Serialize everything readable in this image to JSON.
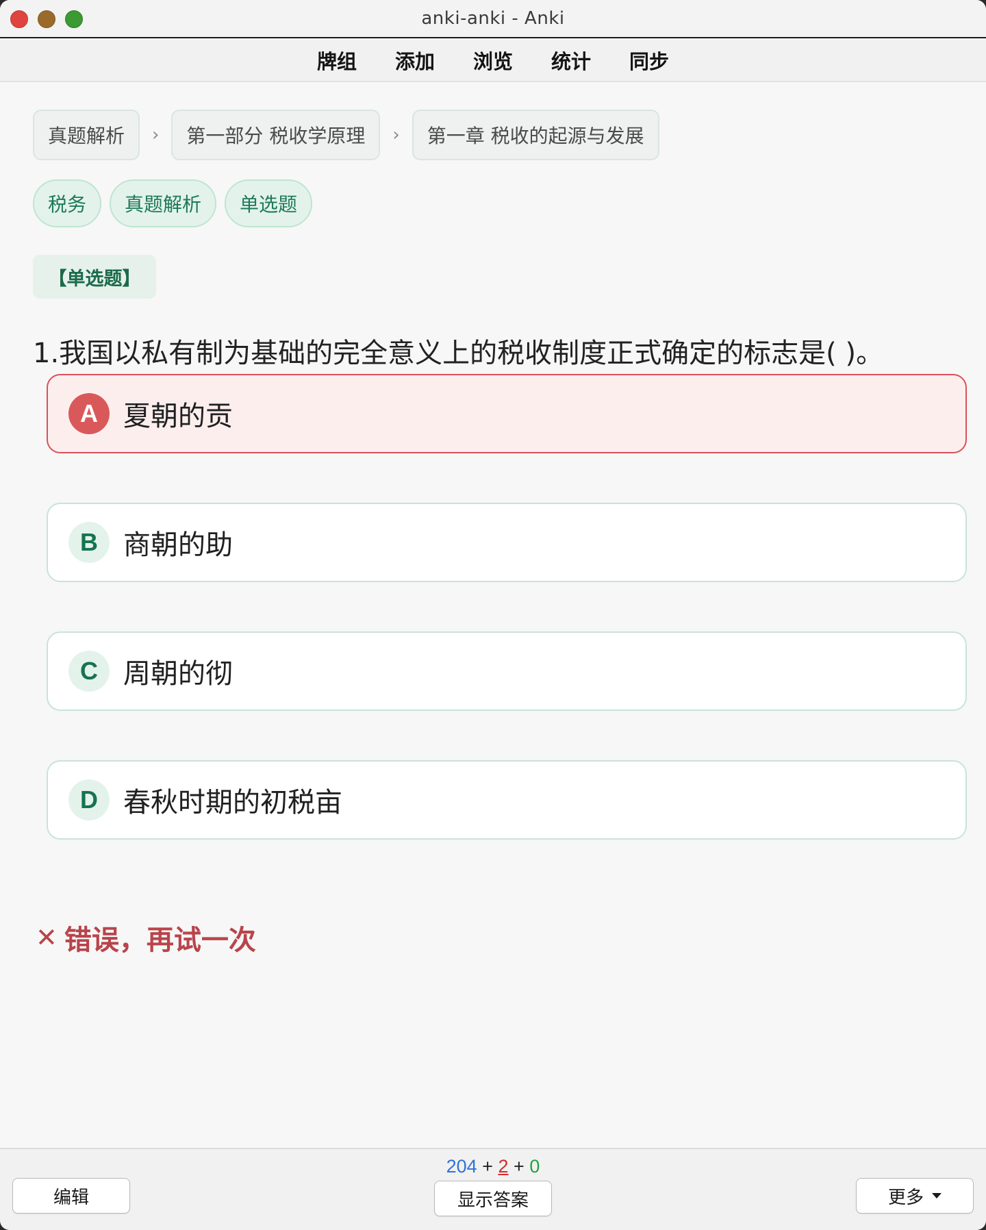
{
  "window": {
    "title": "anki-anki - Anki"
  },
  "toolbar": {
    "items": [
      "牌组",
      "添加",
      "浏览",
      "统计",
      "同步"
    ]
  },
  "breadcrumb": {
    "items": [
      "真题解析",
      "第一部分 税收学原理",
      "第一章 税收的起源与发展"
    ],
    "separator": "›"
  },
  "tags": [
    "税务",
    "真题解析",
    "单选题"
  ],
  "question": {
    "type_label": "【单选题】",
    "text": "1.我国以私有制为基础的完全意义上的税收制度正式确定的标志是( )。"
  },
  "options": [
    {
      "letter": "A",
      "text": "夏朝的贡",
      "state": "wrong"
    },
    {
      "letter": "B",
      "text": "商朝的助",
      "state": "normal"
    },
    {
      "letter": "C",
      "text": "周朝的彻",
      "state": "normal"
    },
    {
      "letter": "D",
      "text": "春秋时期的初税亩",
      "state": "normal"
    }
  ],
  "feedback": {
    "icon": "✕",
    "text": "错误，再试一次"
  },
  "bottom": {
    "counts": {
      "new": "204",
      "learn": "2",
      "review": "0",
      "plus": "+"
    },
    "edit_label": "编辑",
    "show_answer_label": "显示答案",
    "more_label": "更多"
  },
  "colors": {
    "accent_green": "#1d7a55",
    "wrong_red": "#d9505a",
    "new_blue": "#2f72d6",
    "learn_red": "#d22c2c",
    "review_green": "#21a33d"
  }
}
